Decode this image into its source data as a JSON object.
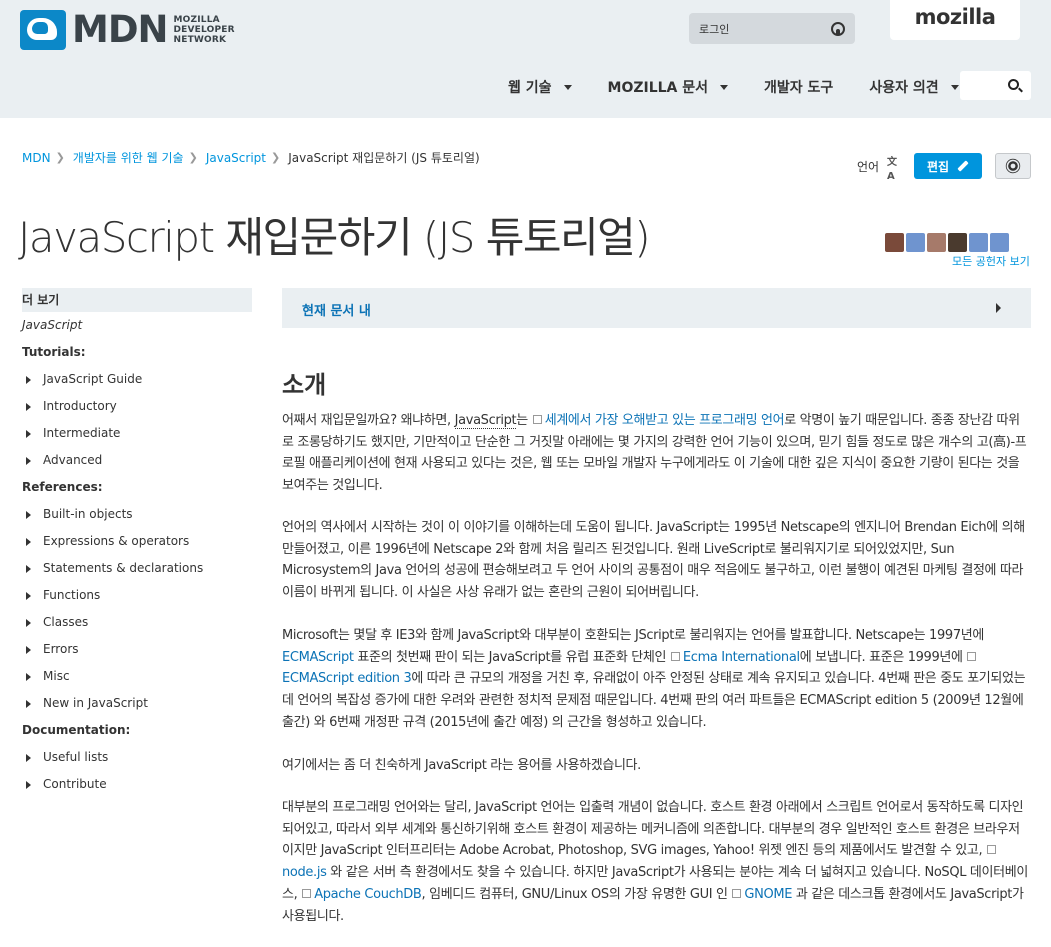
{
  "header": {
    "logo_text": "MDN",
    "logo_sub_1": "MOZILLA",
    "logo_sub_2": "DEVELOPER",
    "logo_sub_3": "NETWORK",
    "login_label": "로그인",
    "mozilla_label": "mozilla",
    "nav": [
      {
        "label": "웹 기술"
      },
      {
        "label": "MOZILLA 문서"
      },
      {
        "label": "개발자 도구"
      },
      {
        "label": "사용자 의견"
      }
    ]
  },
  "breadcrumb": {
    "items": [
      "MDN",
      "개발자를 위한 웹 기술",
      "JavaScript"
    ],
    "current": "JavaScript 재입문하기 (JS 튜토리얼)"
  },
  "toolbar": {
    "language_label": "언어",
    "edit_label": "편집"
  },
  "page_title": "JavaScript 재입문하기 (JS 튜토리얼)",
  "contributors": {
    "all_label": "모든 공헌자 보기",
    "avatar_colors": [
      "#7a4a3a",
      "#6f94cf",
      "#a67a6a",
      "#4a3a2e",
      "#6f94cf",
      "#6f94cf"
    ]
  },
  "sidebar": {
    "header": "더 보기",
    "top_link": "JavaScript",
    "tutorials_label": "Tutorials:",
    "tutorials": [
      "JavaScript Guide",
      "Introductory",
      "Intermediate",
      "Advanced"
    ],
    "references_label": "References:",
    "references": [
      "Built-in objects",
      "Expressions & operators",
      "Statements & declarations",
      "Functions",
      "Classes",
      "Errors",
      "Misc",
      "New in JavaScript"
    ],
    "documentation_label": "Documentation:",
    "documentation": [
      "Useful lists",
      "Contribute"
    ]
  },
  "toc": {
    "title": "현재 문서 내"
  },
  "main": {
    "heading": "소개",
    "p1_a": "어째서 재입문일까요? 왜냐하면, ",
    "p1_abbr": "JavaScript",
    "p1_b": "는 ",
    "p1_link": "세계에서 가장 오해받고 있는 프로그래밍 언어",
    "p1_c": "로 악명이 높기 때문입니다. 종종 장난감 따위로 조롱당하기도 했지만, 기만적이고 단순한 그 거짓말 아래에는 몇 가지의 강력한 언어 기능이 있으며, 믿기 힘들 정도로 많은 개수의 고(高)-프로필 애플리케이션에 현재 사용되고 있다는 것은, 웹 또는 모바일 개발자 누구에게라도 이 기술에 대한 깊은 지식이 중요한 기량이 된다는 것을 보여주는 것입니다.",
    "p2": "언어의 역사에서 시작하는 것이 이 이야기를 이해하는데 도움이 됩니다. JavaScript는 1995년 Netscape의 엔지니어 Brendan Eich에 의해 만들어졌고, 이른 1996년에 Netscape 2와 함께 처음 릴리즈 된것입니다. 원래 LiveScript로 불리워지기로 되어있었지만, Sun Microsystem의 Java 언어의 성공에 편승해보려고 두 언어 사이의 공통점이 매우 적음에도 불구하고, 이런 불행이 예견된 마케팅 결정에 따라 이름이 바뀌게 됩니다. 이 사실은 사상 유래가 없는 혼란의 근원이 되어버립니다.",
    "p3_a": "Microsoft는 몇달 후 IE3와 함께 JavaScript와 대부분이 호환되는 JScript로 불리워지는 언어를 발표합니다. Netscape는 1997년에 ",
    "p3_link1": "ECMAScript",
    "p3_b": " 표준의 첫번째 판이 되는 JavaScript를 유럽 표준화 단체인 ",
    "p3_link2": "Ecma International",
    "p3_c": "에 보냅니다. 표준은 1999년에 ",
    "p3_link3": "ECMAScript edition 3",
    "p3_d": "에 따라 큰 규모의 개정을 거친 후, 유래없이 아주 안정된 상태로 계속 유지되고 있습니다. 4번째 판은 중도 포기되었는데 언어의 복잡성 증가에 대한 우려와 관련한 정치적 문제점 때문입니다. 4번째 판의 여러 파트들은 ECMAScript edition 5 (2009년 12월에 출간) 와 6번째 개정판 규격 (2015년에 출간 예정) 의 근간을 형성하고 있습니다.",
    "p4": "여기에서는 좀 더 친숙하게 JavaScript 라는 용어를 사용하겠습니다.",
    "p5_a": "대부분의 프로그래밍 언어와는 달리, JavaScript 언어는 입출력 개념이 없습니다. 호스트 환경 아래에서 스크립트 언어로서 동작하도록 디자인 되어있고, 따라서 외부 세계와 통신하기위해 호스트 환경이 제공하는 메커니즘에 의존합니다. 대부분의 경우 일반적인 호스트 환경은 브라우저이지만 JavaScript 인터프리터는 Adobe Acrobat, Photoshop, SVG images, Yahoo! 위젯 엔진 등의 제품에서도 발견할 수 있고, ",
    "p5_link1": "node.js",
    "p5_b": " 와 같은 서버 측 환경에서도 찾을 수 있습니다. 하지만 JavaScript가 사용되는 분야는 계속 더 넓혀지고 있습니다. NoSQL 데이터베이스, ",
    "p5_link2": "Apache CouchDB",
    "p5_c": ", 임베디드 컴퓨터, GNU/Linux OS의 가장 유명한 GUI 인 ",
    "p5_link3": "GNOME",
    "p5_d": " 과 같은 데스크톱 환경에서도 JavaScript가 사용됩니다."
  }
}
